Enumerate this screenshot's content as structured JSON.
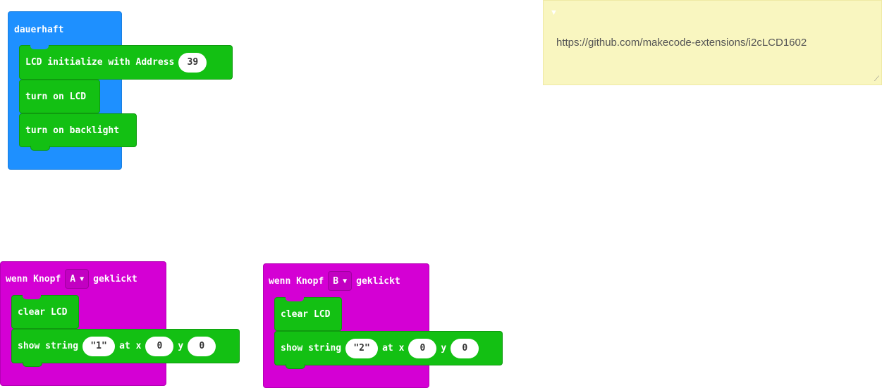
{
  "forever_block": {
    "label": "dauerhaft",
    "lcd_init_label": "LCD initialize with Address",
    "lcd_init_address": "39",
    "turn_on_lcd_label": "turn on LCD",
    "turn_on_backlight_label": "turn on backlight"
  },
  "button_a_block": {
    "prefix": "wenn Knopf",
    "button": "A",
    "suffix": "geklickt",
    "clear_label": "clear LCD",
    "show_label": "show string",
    "string_value": "\"1\"",
    "at_x_label": "at x",
    "x_value": "0",
    "y_label": "y",
    "y_value": "0"
  },
  "button_b_block": {
    "prefix": "wenn Knopf",
    "button": "B",
    "suffix": "geklickt",
    "clear_label": "clear LCD",
    "show_label": "show string",
    "string_value": "\"2\"",
    "at_x_label": "at x",
    "x_value": "0",
    "y_label": "y",
    "y_value": "0"
  },
  "comment": {
    "text": "https://github.com/makecode-extensions/i2cLCD1602"
  },
  "colors": {
    "basic_blue": "#1e90ff",
    "input_magenta": "#d400d4",
    "lcd_green": "#13c013",
    "comment_yellow": "#f9f6c0"
  }
}
